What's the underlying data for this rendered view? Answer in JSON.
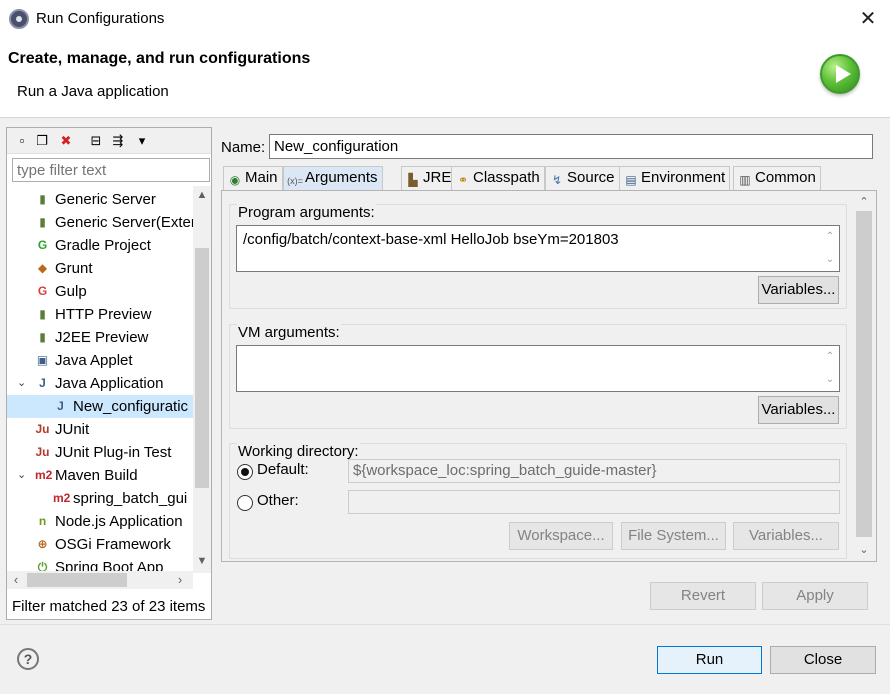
{
  "window": {
    "title": "Run Configurations",
    "close_glyph": "✕"
  },
  "header": {
    "title": "Create, manage, and run configurations",
    "subtitle": "Run a Java application",
    "badge_icon": "run-icon"
  },
  "left": {
    "toolbar": [
      {
        "name": "new-configuration-icon",
        "glyph": "▫"
      },
      {
        "name": "duplicate-icon",
        "glyph": "❐"
      },
      {
        "name": "delete-icon",
        "glyph": "✖"
      },
      {
        "name": "collapse-all-icon",
        "glyph": "⊟"
      },
      {
        "name": "filter-icon",
        "glyph": "⇶"
      },
      {
        "name": "dropdown-icon",
        "glyph": "▾"
      }
    ],
    "filter_placeholder": "type filter text",
    "tree": [
      {
        "label": "Generic Server",
        "icon": "server-icon",
        "glyph": "▮",
        "color": "#5a7d3b",
        "indent": 1
      },
      {
        "label": "Generic Server(Exter",
        "icon": "server-icon",
        "glyph": "▮",
        "color": "#5a7d3b",
        "indent": 1
      },
      {
        "label": "Gradle Project",
        "icon": "gradle-icon",
        "glyph": "G",
        "color": "#2ea22e",
        "indent": 1
      },
      {
        "label": "Grunt",
        "icon": "grunt-icon",
        "glyph": "◆",
        "color": "#b86b1a",
        "indent": 1
      },
      {
        "label": "Gulp",
        "icon": "gulp-icon",
        "glyph": "G",
        "color": "#d9413b",
        "indent": 1
      },
      {
        "label": "HTTP Preview",
        "icon": "server-icon",
        "glyph": "▮",
        "color": "#5a7d3b",
        "indent": 1
      },
      {
        "label": "J2EE Preview",
        "icon": "server-icon",
        "glyph": "▮",
        "color": "#5a7d3b",
        "indent": 1
      },
      {
        "label": "Java Applet",
        "icon": "applet-icon",
        "glyph": "▣",
        "color": "#3d5f8a",
        "indent": 1
      },
      {
        "label": "Java Application",
        "icon": "java-app-icon",
        "glyph": "J",
        "color": "#3d5f8a",
        "indent": 1,
        "expander": "⌄"
      },
      {
        "label": "New_configuratic",
        "icon": "java-app-icon",
        "glyph": "J",
        "color": "#3d5f8a",
        "indent": 2,
        "selected": true
      },
      {
        "label": "JUnit",
        "icon": "junit-icon",
        "glyph": "Ju",
        "color": "#b23a2a",
        "indent": 1
      },
      {
        "label": "JUnit Plug-in Test",
        "icon": "junit-plugin-icon",
        "glyph": "Ju",
        "color": "#b23a2a",
        "indent": 1
      },
      {
        "label": "Maven Build",
        "icon": "maven-icon",
        "glyph": "m2",
        "color": "#c2262b",
        "indent": 1,
        "expander": "⌄"
      },
      {
        "label": "spring_batch_gui",
        "icon": "maven-icon",
        "glyph": "m2",
        "color": "#c2262b",
        "indent": 2
      },
      {
        "label": "Node.js Application",
        "icon": "nodejs-icon",
        "glyph": "n",
        "color": "#6a9a1f",
        "indent": 1
      },
      {
        "label": "OSGi Framework",
        "icon": "osgi-icon",
        "glyph": "⊕",
        "color": "#b5651d",
        "indent": 1
      },
      {
        "label": "Spring Boot App",
        "icon": "spring-boot-icon",
        "glyph": "⏻",
        "color": "#5aa02c",
        "indent": 1
      }
    ],
    "status": "Filter matched 23 of 23 items"
  },
  "right": {
    "name_label": "Name:",
    "name_value": "New_configuration",
    "tabs": [
      {
        "label": "Main",
        "icon": "main-tab-icon",
        "glyph": "◉",
        "color": "#2e7d32"
      },
      {
        "label": "Arguments",
        "icon": "arguments-tab-icon",
        "glyph": "(x)=",
        "color": "#555555",
        "active": true
      },
      {
        "label": "JRE",
        "icon": "jre-tab-icon",
        "glyph": "▙",
        "color": "#7a5c2e"
      },
      {
        "label": "Classpath",
        "icon": "classpath-tab-icon",
        "glyph": "⚭",
        "color": "#b8860b"
      },
      {
        "label": "Source",
        "icon": "source-tab-icon",
        "glyph": "↯",
        "color": "#4a6fa5"
      },
      {
        "label": "Environment",
        "icon": "environment-tab-icon",
        "glyph": "▤",
        "color": "#3d5f8a"
      },
      {
        "label": "Common",
        "icon": "common-tab-icon",
        "glyph": "▥",
        "color": "#555555"
      }
    ],
    "program_args": {
      "title": "Program arguments:",
      "value": "/config/batch/context-base-xml HelloJob bseYm=201803",
      "variables": "Variables..."
    },
    "vm_args": {
      "title": "VM arguments:",
      "value": "",
      "variables": "Variables..."
    },
    "working_dir": {
      "title": "Working directory:",
      "default_label": "Default:",
      "default_value": "${workspace_loc:spring_batch_guide-master}",
      "other_label": "Other:",
      "other_value": "",
      "workspace": "Workspace...",
      "filesystem": "File System...",
      "variables": "Variables..."
    },
    "revert": "Revert",
    "apply": "Apply"
  },
  "footer": {
    "help": "?",
    "run": "Run",
    "close": "Close"
  }
}
